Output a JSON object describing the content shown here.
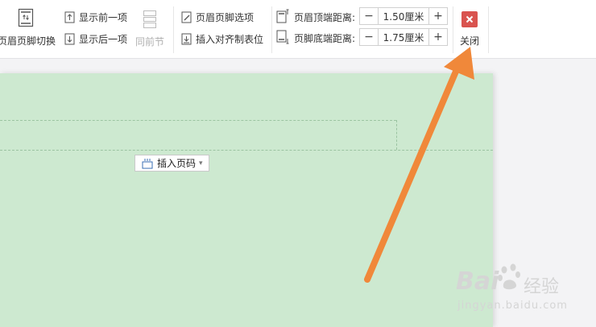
{
  "ribbon": {
    "switch_label": "页眉页脚切换",
    "show_prev_label": "显示前一项",
    "show_next_label": "显示后一项",
    "prev_section_label": "同前节",
    "hf_options_label": "页眉页脚选项",
    "insert_tab_label": "插入对齐制表位",
    "header_top_label": "页眉顶端距离:",
    "header_top_value": "1.50厘米",
    "footer_bottom_label": "页脚底端距离:",
    "footer_bottom_value": "1.75厘米",
    "minus_symbol": "−",
    "plus_symbol": "+",
    "close_label": "关闭"
  },
  "page": {
    "insert_page_number_label": "插入页码",
    "insert_page_number_caret": "▾"
  },
  "watermark": {
    "brand": "Bai",
    "brand2": "经验",
    "url": "jingyan.baidu.com"
  },
  "colors": {
    "page_background": "#cde9d0",
    "close_button": "#d9534f",
    "annotation_arrow": "#f0883a"
  }
}
